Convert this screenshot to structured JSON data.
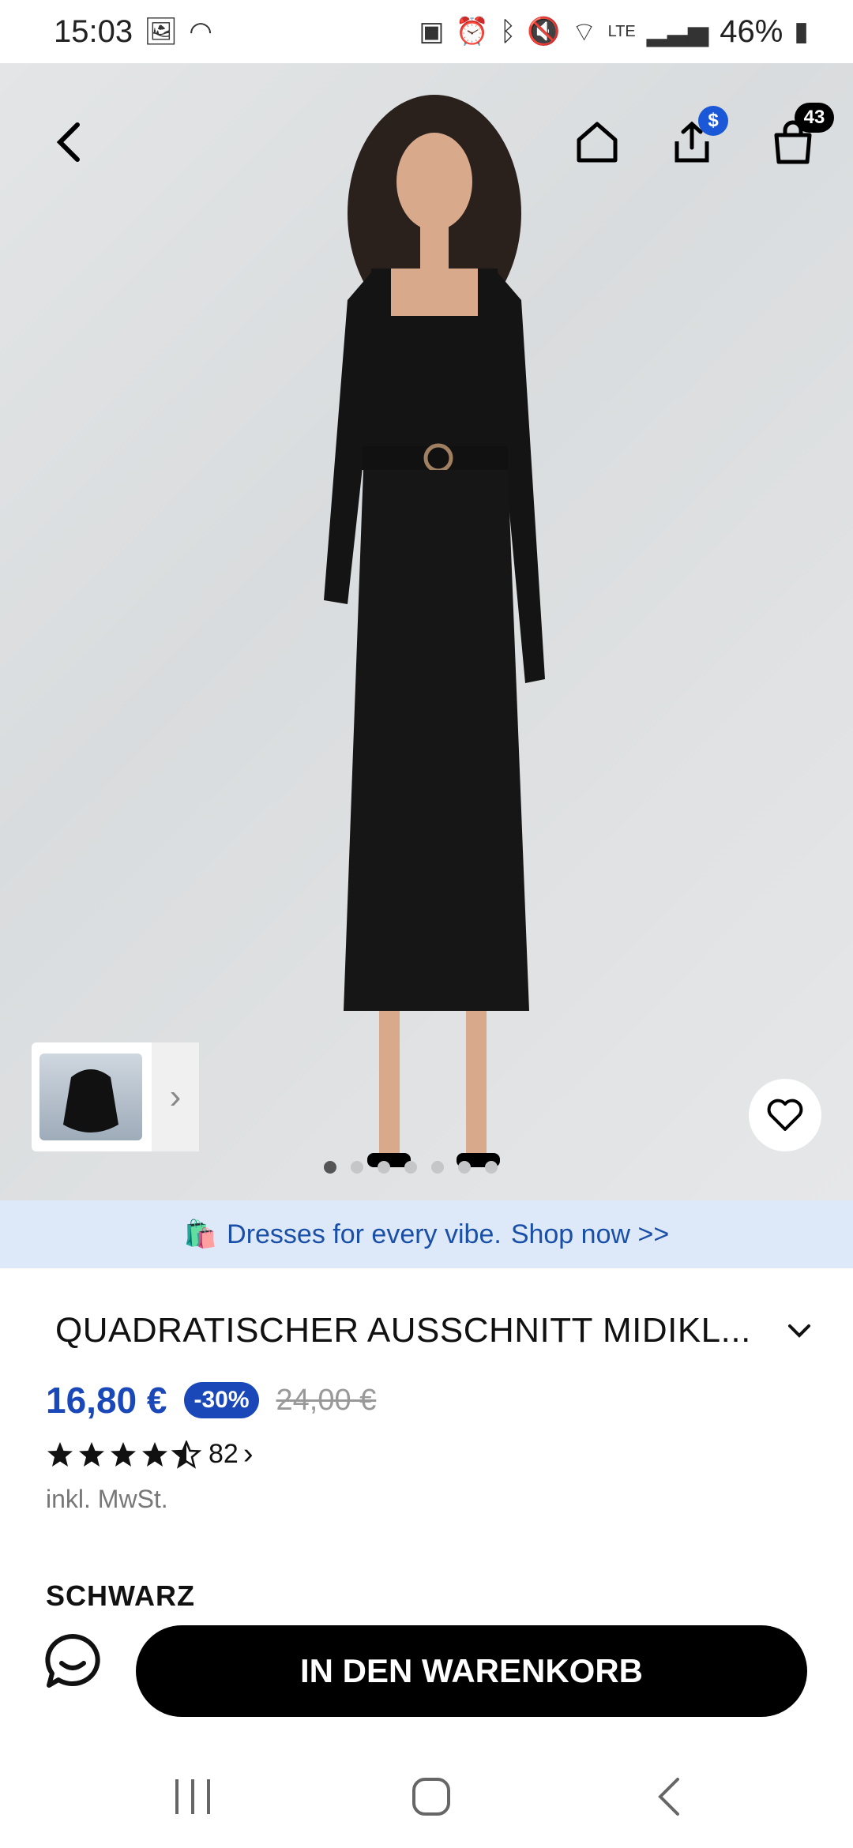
{
  "status_bar": {
    "time": "15:03",
    "battery": "46%",
    "network": "LTE"
  },
  "header": {
    "share_badge": "$",
    "cart_count": "43"
  },
  "gallery": {
    "page_count": 7,
    "current_page": 1
  },
  "promo": {
    "emoji": "🛍️",
    "text": "Dresses for every vibe.",
    "link": "Shop now >>"
  },
  "product": {
    "title": "QUADRATISCHER AUSSCHNITT MIDIKL...",
    "price": "16,80 €",
    "discount": "-30%",
    "old_price": "24,00 €",
    "rating": 4.5,
    "review_count": "82",
    "tax_note": "inkl. MwSt.",
    "color": "SCHWARZ"
  },
  "actions": {
    "add_to_cart": "IN DEN WARENKORB"
  },
  "colors": {
    "accent": "#1a48b8",
    "promo_bg": "#dde9f8",
    "button": "#000000"
  }
}
